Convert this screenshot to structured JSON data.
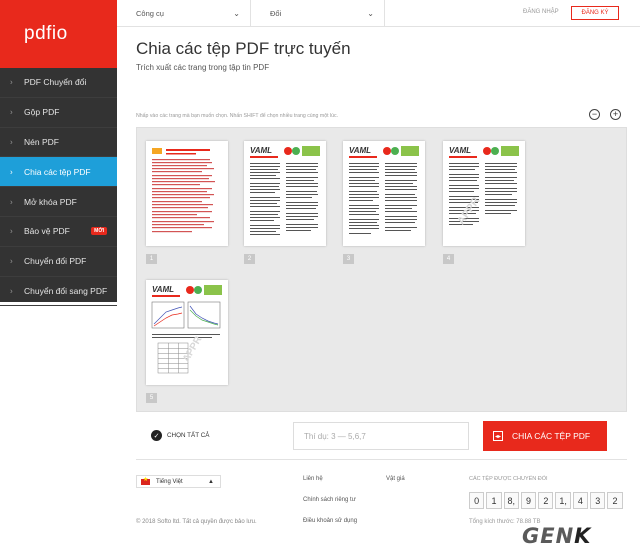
{
  "brand": {
    "logo_text": "pdfio",
    "accent": "#e8291c",
    "active": "#1e9fd9",
    "sidebar_bg": "#333333"
  },
  "topbar": {
    "menu_tools": "Công cụ",
    "menu_convert": "Đổi",
    "login": "ĐĂNG NHẬP",
    "signup": "ĐĂNG KÝ"
  },
  "sidebar": {
    "items": [
      {
        "label": "PDF Chuyển đổi",
        "active": false
      },
      {
        "label": "Gộp PDF",
        "active": false
      },
      {
        "label": "Nén PDF",
        "active": false
      },
      {
        "label": "Chia các tệp PDF",
        "active": true
      },
      {
        "label": "Mở khóa PDF",
        "active": false
      },
      {
        "label": "Bảo vệ PDF",
        "active": false,
        "badge": "MỚI"
      },
      {
        "label": "Chuyển đổi PDF",
        "active": false
      },
      {
        "label": "Chuyển đổi sang PDF",
        "active": false
      }
    ]
  },
  "main": {
    "title": "Chia các tệp PDF trực tuyến",
    "subtitle": "Trích xuất các trang trong tập tin PDF",
    "hint": "Nhấp vào các trang mà bạn muốn chọn. Nhấn SHIFT để chọn nhiều trang cùng một lúc."
  },
  "zoom": {
    "out_symbol": "−",
    "in_symbol": "+"
  },
  "pages": [
    "1",
    "2",
    "3",
    "4",
    "5"
  ],
  "actions": {
    "select_all": "CHỌN TẤT CẢ",
    "range_placeholder": "Thí dụ: 3 — 5,6,7",
    "split_button": "CHIA CÁC TỆP PDF"
  },
  "footer": {
    "language": "Tiếng Việt",
    "links": {
      "contact": "Liên hệ",
      "pricing": "Vật giá",
      "privacy": "Chính sách riêng tư",
      "terms": "Điều khoản sử dụng"
    },
    "counter_label": "CÁC TỆP ĐƯỢC CHUYỂN ĐỔI",
    "counter_digits": [
      "0",
      "1",
      "8,",
      "9",
      "2",
      "1,",
      "4",
      "3",
      "2"
    ],
    "total_size": "Tổng kích thước: 78.88 TB",
    "copyright": "© 2018 Softo ltd. Tất cả quyền được bảo lưu."
  },
  "watermark": {
    "text_main": "GEN",
    "text_end": "K"
  }
}
